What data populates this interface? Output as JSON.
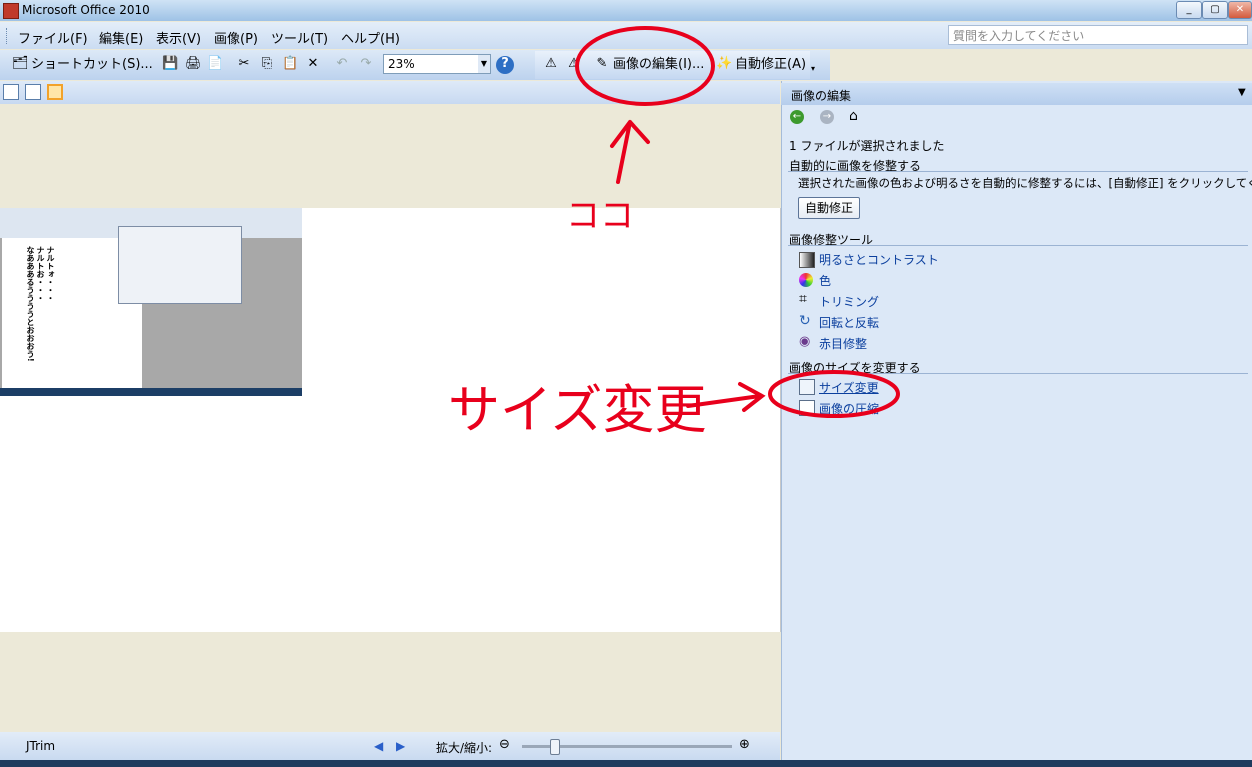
{
  "window": {
    "title": "Microsoft Office 2010"
  },
  "menu": {
    "items": [
      "ファイル(F)",
      "編集(E)",
      "表示(V)",
      "画像(P)",
      "ツール(T)",
      "ヘルプ(H)"
    ],
    "help_search_placeholder": "質問を入力してください"
  },
  "toolbar": {
    "shortcut_label": "ショートカット(S)...",
    "zoom_value": "23%",
    "edit_picture_label": "画像の編集(I)...",
    "autocorrect_label": "自動修正(A)"
  },
  "status": {
    "app_name": "JTrim",
    "zoom_label": "拡大/縮小:",
    "zoom_level_fraction": 0.15
  },
  "pane": {
    "title": "画像の編集",
    "selected_text": "1 ファイルが選択されました",
    "auto_section": "自動的に画像を修整する",
    "auto_desc": "選択された画像の色および明るさを自動的に修整するには、[自動修正] をクリックしてください。",
    "auto_button": "自動修正",
    "tools_section": "画像修整ツール",
    "tools": [
      "明るさとコントラスト",
      "色",
      "トリミング",
      "回転と反転",
      "赤目修整"
    ],
    "size_section": "画像のサイズを変更する",
    "size_links": [
      "サイズ変更",
      "画像の圧縮"
    ]
  },
  "thumbnail": {
    "vertical_text": [
      "ナルトォ・・・",
      "ナルトお・・・",
      "なあああるううううとおおおう!"
    ]
  },
  "annotations": {
    "here_label": "ココ",
    "resize_label": "サイズ変更"
  },
  "colors": {
    "annotation_red": "#e8001c",
    "pane_bg": "#dce8f7",
    "link": "#0b3f9e"
  }
}
